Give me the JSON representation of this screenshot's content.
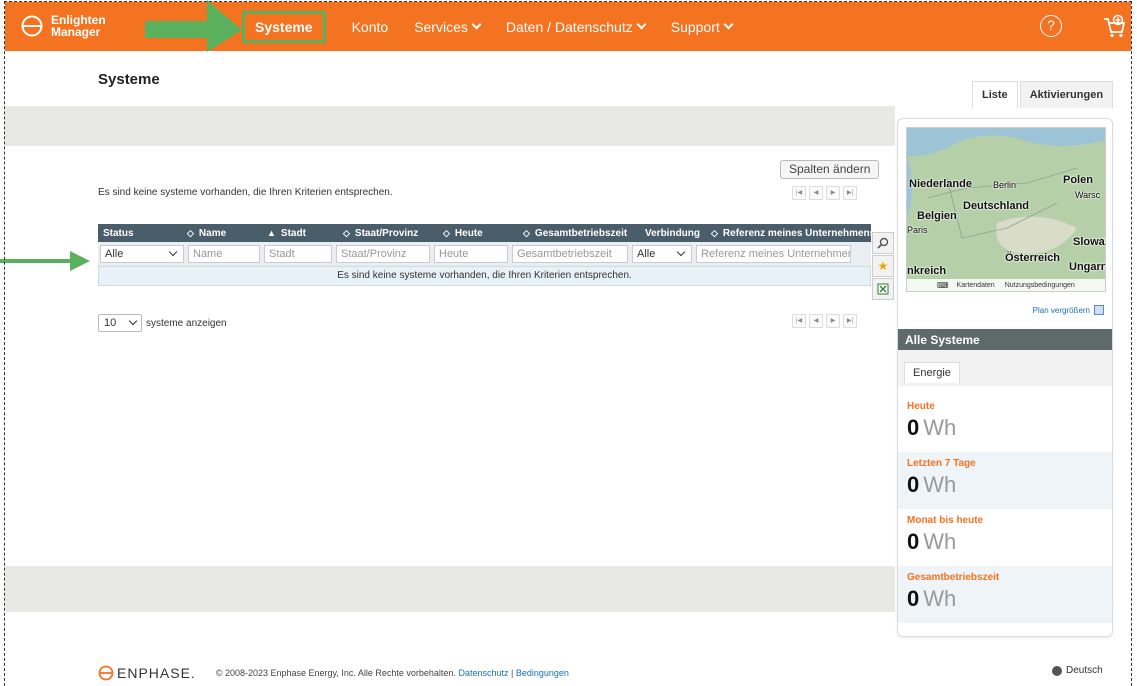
{
  "brand": {
    "line1": "Enlighten",
    "line2": "Manager",
    "color": "#f37321"
  },
  "nav": {
    "items": [
      {
        "label": "Systeme",
        "active": true,
        "dropdown": false
      },
      {
        "label": "Konto",
        "active": false,
        "dropdown": false
      },
      {
        "label": "Services",
        "active": false,
        "dropdown": true
      },
      {
        "label": "Daten / Datenschutz",
        "active": false,
        "dropdown": true
      },
      {
        "label": "Support",
        "active": false,
        "dropdown": true
      }
    ],
    "help_icon": "?"
  },
  "page": {
    "title": "Systeme",
    "tabs": [
      {
        "label": "Liste",
        "active": true
      },
      {
        "label": "Aktivierungen",
        "active": false
      }
    ]
  },
  "list": {
    "change_columns": "Spalten ändern",
    "empty_message_top": "Es sind keine systeme vorhanden, die Ihren Kriterien entsprechen.",
    "empty_message_row": "Es sind keine systeme vorhanden, die Ihren Kriterien entsprechen.",
    "columns": [
      {
        "label": "Status",
        "sort": ""
      },
      {
        "label": "Name",
        "sort": "◇"
      },
      {
        "label": "Stadt",
        "sort": "▲"
      },
      {
        "label": "Staat/Provinz",
        "sort": "◇"
      },
      {
        "label": "Heute",
        "sort": "◇"
      },
      {
        "label": "Gesamtbetriebszeit",
        "sort": "◇"
      },
      {
        "label": "Verbindung",
        "sort": "◇"
      },
      {
        "label": "Referenz meines Unternehmens",
        "sort": "◇"
      }
    ],
    "filters": {
      "status": "Alle",
      "name": "Name",
      "stadt": "Stadt",
      "staat": "Staat/Provinz",
      "heute": "Heute",
      "gesamt": "Gesamtbetriebszeit",
      "verbindung": "Alle",
      "referenz": "Referenz meines Unternehmens"
    },
    "page_size": "10",
    "page_size_label": "systeme anzeigen"
  },
  "map": {
    "labels": [
      "Niederlande",
      "Berlin",
      "Polen",
      "Warsc",
      "Deutschland",
      "Belgien",
      "Paris",
      "Slowak",
      "Österreich",
      "Ungarn",
      "nkreich"
    ],
    "footer_data": "Kartendaten",
    "footer_terms": "Nutzungsbedingungen",
    "enlarge": "Plan vergrößern"
  },
  "summary": {
    "title": "Alle Systeme",
    "tab": "Energie",
    "stats": [
      {
        "label": "Heute",
        "value": "0",
        "unit": "Wh"
      },
      {
        "label": "Letzten 7 Tage",
        "value": "0",
        "unit": "Wh"
      },
      {
        "label": "Monat bis heute",
        "value": "0",
        "unit": "Wh"
      },
      {
        "label": "Gesamtbetriebszeit",
        "value": "0",
        "unit": "Wh"
      }
    ]
  },
  "footer": {
    "brand": "ENPHASE.",
    "copyright": "© 2008-2023 Enphase Energy, Inc. Alle Rechte vorbehalten.",
    "privacy": "Datenschutz",
    "separator": "|",
    "terms": "Bedingungen",
    "language": "Deutsch"
  },
  "colors": {
    "accent": "#f37321",
    "highlight": "#5bb05e",
    "grid_header": "#4a5d6b"
  }
}
